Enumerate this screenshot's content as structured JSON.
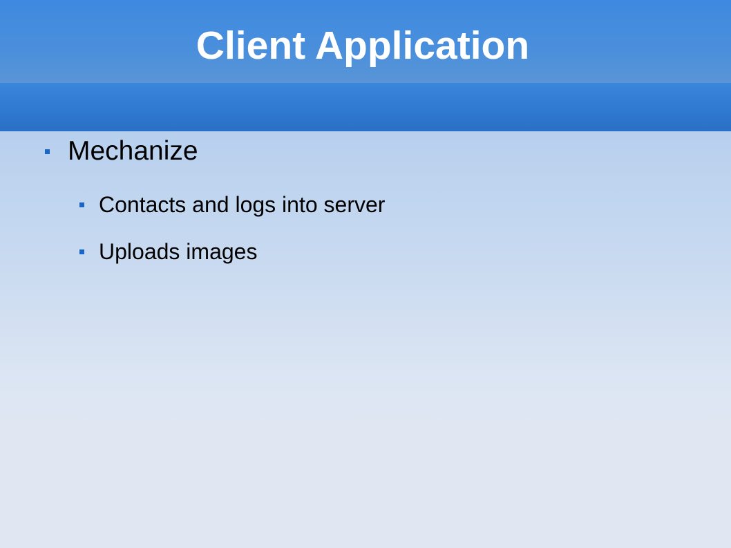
{
  "slide": {
    "title": "Client Application",
    "bullets": [
      {
        "text": "Mechanize",
        "children": [
          {
            "text": "Contacts and logs into server"
          },
          {
            "text": "Uploads images"
          }
        ]
      }
    ]
  },
  "colors": {
    "title_bar": "#4a8fdc",
    "title_band": "#2f79d0",
    "bullet": "#1a66c8",
    "title_text": "#ffffff",
    "body_text": "#000000"
  }
}
